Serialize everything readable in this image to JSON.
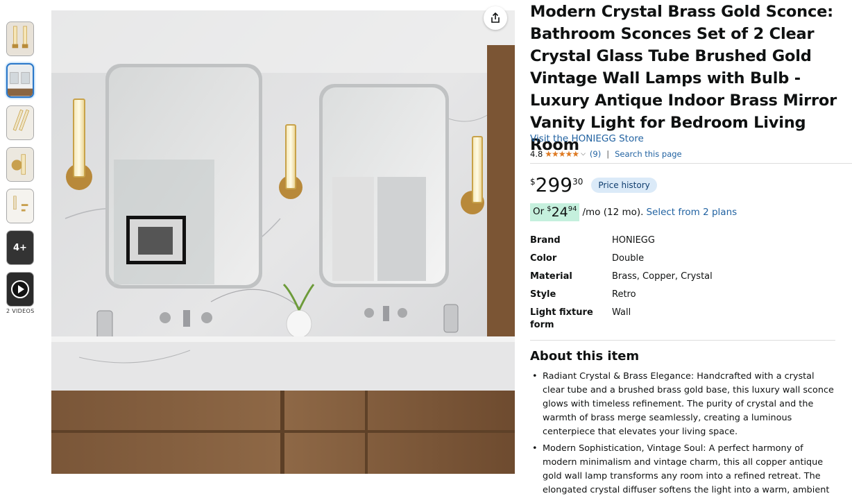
{
  "thumbnails": {
    "more_label": "4+",
    "videos_label": "2 VIDEOS"
  },
  "product": {
    "title": "Modern Crystal Brass Gold Sconce: Bathroom Sconces Set of 2 Clear Crystal Glass Tube Brushed Gold Vintage Wall Lamps with Bulb - Luxury Antique Indoor Brass Mirror Vanity Light for Bedroom Living Room",
    "store_link": "Visit the HONIEGG Store",
    "rating_value": "4.8",
    "stars": "★★★★★",
    "rating_count": "(9)",
    "separator": "|",
    "search_link": "Search this page"
  },
  "price": {
    "currency": "$",
    "dollars": "299",
    "cents": "30",
    "price_history_label": "Price history",
    "monthly_prefix": "Or",
    "monthly_currency": "$",
    "monthly_dollars": "24",
    "monthly_cents": "94",
    "monthly_suffix": "/mo (12 mo).",
    "plans_link": "Select from 2 plans"
  },
  "specs": [
    {
      "key": "Brand",
      "value": "HONIEGG"
    },
    {
      "key": "Color",
      "value": "Double"
    },
    {
      "key": "Material",
      "value": "Brass, Copper, Crystal"
    },
    {
      "key": "Style",
      "value": "Retro"
    },
    {
      "key": "Light fixture form",
      "value": "Wall"
    }
  ],
  "about": {
    "title": "About this item",
    "bullets": [
      "Radiant Crystal & Brass Elegance: Handcrafted with a crystal clear tube and a brushed brass gold base, this luxury wall sconce glows with timeless refinement. The purity of crystal and the warmth of brass merge seamlessly, creating a luminous centerpiece that elevates your living space.",
      "Modern Sophistication, Vintage Soul: A perfect harmony of modern minimalism and vintage charm, this all copper antique gold wall lamp transforms any room into a refined retreat. The elongated crystal diffuser softens the light into a warm, ambient"
    ]
  },
  "icons": {
    "share": "share-icon",
    "play": "play-icon"
  },
  "colors": {
    "link": "#2162a1",
    "star": "#de7921",
    "price_history_bg": "#dbeaf8",
    "monthly_bg": "#c5f0dd",
    "active_thumb_border": "#2a77c9"
  }
}
